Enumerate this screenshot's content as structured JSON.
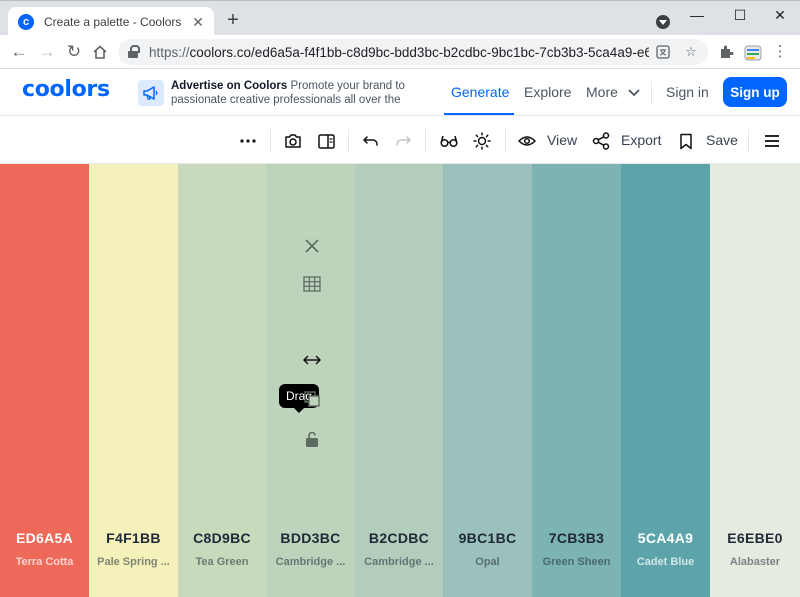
{
  "browser": {
    "tab_title": "Create a palette - Coolors",
    "favicon_letter": "c",
    "url_scheme": "https://",
    "url_rest": "coolors.co/ed6a5a-f4f1bb-c8d9bc-bdd3bc-b2cdbc-9bc1bc-7cb3b3-5ca4a9-e6..."
  },
  "header": {
    "logo": "coolors",
    "ad_title": "Advertise on Coolors",
    "ad_body": "Promote your brand to passionate creative professionals all over the",
    "nav": {
      "generate": "Generate",
      "explore": "Explore",
      "more": "More",
      "sign_in": "Sign in",
      "sign_up": "Sign up"
    }
  },
  "toolbar": {
    "view_label": "View",
    "export_label": "Export",
    "save_label": "Save"
  },
  "palette": {
    "tooltip": "Drag",
    "colors": [
      {
        "hex": "ED6A5A",
        "name": "Terra Cotta",
        "color": "#ED6A5A",
        "text": "dark"
      },
      {
        "hex": "F4F1BB",
        "name": "Pale Spring ...",
        "color": "#F4F1BB",
        "text": "light"
      },
      {
        "hex": "C8D9BC",
        "name": "Tea Green",
        "color": "#C8D9BC",
        "text": "light"
      },
      {
        "hex": "BDD3BC",
        "name": "Cambridge ...",
        "color": "#BDD3BC",
        "text": "light"
      },
      {
        "hex": "B2CDBC",
        "name": "Cambridge ...",
        "color": "#B2CDBC",
        "text": "light"
      },
      {
        "hex": "9BC1BC",
        "name": "Opal",
        "color": "#9BC1BC",
        "text": "light"
      },
      {
        "hex": "7CB3B3",
        "name": "Green Sheen",
        "color": "#7CB3B3",
        "text": "light"
      },
      {
        "hex": "5CA4A9",
        "name": "Cadet Blue",
        "color": "#5CA4A9",
        "text": "dark"
      },
      {
        "hex": "E6EBE0",
        "name": "Alabaster",
        "color": "#E6EBE0",
        "text": "light"
      }
    ]
  }
}
